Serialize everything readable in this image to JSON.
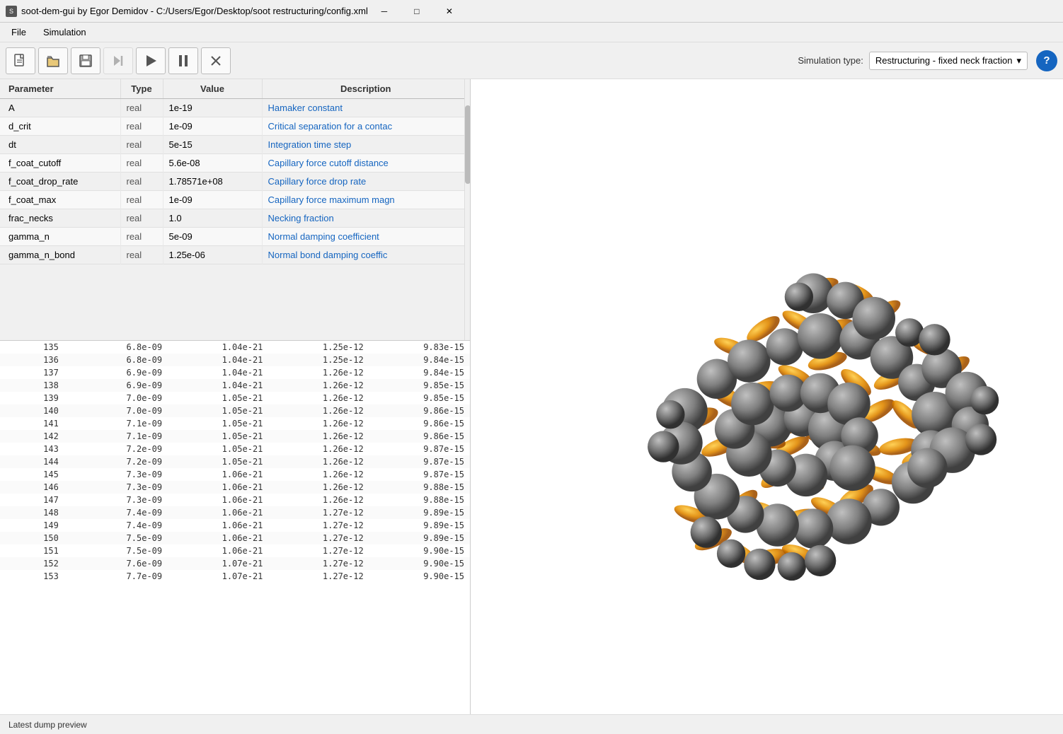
{
  "titlebar": {
    "title": "soot-dem-gui by Egor Demidov - C:/Users/Egor/Desktop/soot restructuring/config.xml",
    "icon": "S",
    "minimize": "─",
    "maximize": "□",
    "close": "✕"
  },
  "menubar": {
    "items": [
      {
        "label": "File"
      },
      {
        "label": "Simulation"
      }
    ]
  },
  "toolbar": {
    "new_label": "New",
    "open_label": "Open",
    "save_label": "Save",
    "skip_label": "Skip",
    "play_label": "Play",
    "pause_label": "Pause",
    "stop_label": "Stop"
  },
  "simulation_type": {
    "label": "Simulation type:",
    "value": "Restructuring - fixed neck fraction",
    "dropdown_arrow": "▾"
  },
  "help": {
    "label": "?"
  },
  "param_table": {
    "columns": [
      "Parameter",
      "Type",
      "Value",
      "Description"
    ],
    "rows": [
      {
        "param": "A",
        "type": "real",
        "value": "1e-19",
        "desc": "Hamaker constant"
      },
      {
        "param": "d_crit",
        "type": "real",
        "value": "1e-09",
        "desc": "Critical separation for a contac"
      },
      {
        "param": "dt",
        "type": "real",
        "value": "5e-15",
        "desc": "Integration time step"
      },
      {
        "param": "f_coat_cutoff",
        "type": "real",
        "value": "5.6e-08",
        "desc": "Capillary force cutoff distance"
      },
      {
        "param": "f_coat_drop_rate",
        "type": "real",
        "value": "1.78571e+08",
        "desc": "Capillary force drop rate"
      },
      {
        "param": "f_coat_max",
        "type": "real",
        "value": "1e-09",
        "desc": "Capillary force maximum magn"
      },
      {
        "param": "frac_necks",
        "type": "real",
        "value": "1.0",
        "desc": "Necking fraction"
      },
      {
        "param": "gamma_n",
        "type": "real",
        "value": "5e-09",
        "desc": "Normal damping coefficient"
      },
      {
        "param": "gamma_n_bond",
        "type": "real",
        "value": "1.25e-06",
        "desc": "Normal bond damping coeffic"
      }
    ]
  },
  "data_rows": [
    {
      "col1": "135",
      "col2": "6.8e-09",
      "col3": "1.04e-21",
      "col4": "1.25e-12",
      "col5": "9.83e-15"
    },
    {
      "col1": "136",
      "col2": "6.8e-09",
      "col3": "1.04e-21",
      "col4": "1.25e-12",
      "col5": "9.84e-15"
    },
    {
      "col1": "137",
      "col2": "6.9e-09",
      "col3": "1.04e-21",
      "col4": "1.26e-12",
      "col5": "9.84e-15"
    },
    {
      "col1": "138",
      "col2": "6.9e-09",
      "col3": "1.04e-21",
      "col4": "1.26e-12",
      "col5": "9.85e-15"
    },
    {
      "col1": "139",
      "col2": "7.0e-09",
      "col3": "1.05e-21",
      "col4": "1.26e-12",
      "col5": "9.85e-15"
    },
    {
      "col1": "140",
      "col2": "7.0e-09",
      "col3": "1.05e-21",
      "col4": "1.26e-12",
      "col5": "9.86e-15"
    },
    {
      "col1": "141",
      "col2": "7.1e-09",
      "col3": "1.05e-21",
      "col4": "1.26e-12",
      "col5": "9.86e-15"
    },
    {
      "col1": "142",
      "col2": "7.1e-09",
      "col3": "1.05e-21",
      "col4": "1.26e-12",
      "col5": "9.86e-15"
    },
    {
      "col1": "143",
      "col2": "7.2e-09",
      "col3": "1.05e-21",
      "col4": "1.26e-12",
      "col5": "9.87e-15"
    },
    {
      "col1": "144",
      "col2": "7.2e-09",
      "col3": "1.05e-21",
      "col4": "1.26e-12",
      "col5": "9.87e-15"
    },
    {
      "col1": "145",
      "col2": "7.3e-09",
      "col3": "1.06e-21",
      "col4": "1.26e-12",
      "col5": "9.87e-15"
    },
    {
      "col1": "146",
      "col2": "7.3e-09",
      "col3": "1.06e-21",
      "col4": "1.26e-12",
      "col5": "9.88e-15"
    },
    {
      "col1": "147",
      "col2": "7.3e-09",
      "col3": "1.06e-21",
      "col4": "1.26e-12",
      "col5": "9.88e-15"
    },
    {
      "col1": "148",
      "col2": "7.4e-09",
      "col3": "1.06e-21",
      "col4": "1.27e-12",
      "col5": "9.89e-15"
    },
    {
      "col1": "149",
      "col2": "7.4e-09",
      "col3": "1.06e-21",
      "col4": "1.27e-12",
      "col5": "9.89e-15"
    },
    {
      "col1": "150",
      "col2": "7.5e-09",
      "col3": "1.06e-21",
      "col4": "1.27e-12",
      "col5": "9.89e-15"
    },
    {
      "col1": "151",
      "col2": "7.5e-09",
      "col3": "1.06e-21",
      "col4": "1.27e-12",
      "col5": "9.90e-15"
    },
    {
      "col1": "152",
      "col2": "7.6e-09",
      "col3": "1.07e-21",
      "col4": "1.27e-12",
      "col5": "9.90e-15"
    },
    {
      "col1": "153",
      "col2": "7.7e-09",
      "col3": "1.07e-21",
      "col4": "1.27e-12",
      "col5": "9.90e-15"
    }
  ],
  "statusbar": {
    "text": "Latest dump preview"
  }
}
